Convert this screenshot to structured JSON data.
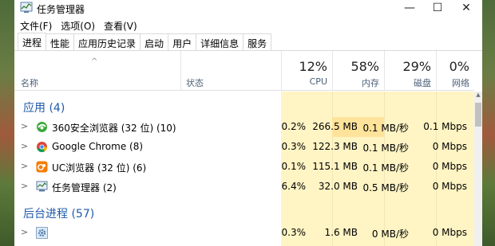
{
  "window": {
    "title": "任务管理器"
  },
  "menu": [
    "文件(F)",
    "选项(O)",
    "查看(V)"
  ],
  "tabs": [
    "进程",
    "性能",
    "应用历史记录",
    "启动",
    "用户",
    "详细信息",
    "服务"
  ],
  "header": {
    "name_label": "名称",
    "status_label": "状态",
    "cpu": {
      "pct": "12%",
      "label": "CPU"
    },
    "mem": {
      "pct": "58%",
      "label": "内存"
    },
    "disk": {
      "pct": "29%",
      "label": "磁盘"
    },
    "net": {
      "pct": "0%",
      "label": "网络"
    }
  },
  "groups": {
    "apps": "应用 (4)",
    "background": "后台进程 (57)"
  },
  "apps": [
    {
      "name": "360安全浏览器 (32 位) (10)",
      "icon": "browser-360-icon",
      "cpu": "0.2%",
      "mem": "266.5 MB",
      "disk": "0.1 MB/秒",
      "net": "0.1 Mbps"
    },
    {
      "name": "Google Chrome (8)",
      "icon": "chrome-icon",
      "cpu": "0.3%",
      "mem": "122.3 MB",
      "disk": "0.1 MB/秒",
      "net": "0 Mbps"
    },
    {
      "name": "UC浏览器 (32 位) (6)",
      "icon": "uc-browser-icon",
      "cpu": "0.1%",
      "mem": "115.1 MB",
      "disk": "0.1 MB/秒",
      "net": "0 Mbps"
    },
    {
      "name": "任务管理器 (2)",
      "icon": "task-manager-icon",
      "cpu": "6.4%",
      "mem": "32.0 MB",
      "disk": "0.5 MB/秒",
      "net": "0 Mbps"
    }
  ],
  "background": [
    {
      "name": "",
      "icon": "gear-icon",
      "cpu": "0.3%",
      "mem": "1.6 MB",
      "disk": "0 MB/秒",
      "net": "0 Mbps"
    }
  ],
  "colors": {
    "accent": "#1e5aa8",
    "column_shade": "#fff4c4",
    "mem_highlight": "#ffe39a"
  }
}
